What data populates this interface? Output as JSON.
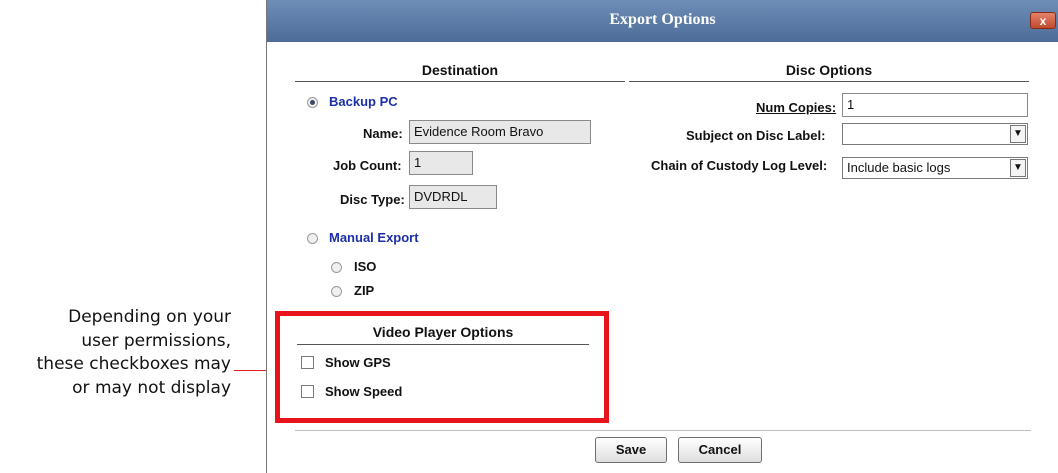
{
  "callout": {
    "lines": [
      "Depending on your",
      "user permissions,",
      "these checkboxes may",
      "or may not display"
    ]
  },
  "dialog": {
    "title": "Export Options",
    "close_label": "x"
  },
  "destination": {
    "heading": "Destination",
    "backup_pc": {
      "label": "Backup PC",
      "selected": true,
      "name_label": "Name:",
      "name_value": "Evidence Room Bravo",
      "job_count_label": "Job Count:",
      "job_count_value": "1",
      "disc_type_label": "Disc Type:",
      "disc_type_value": "DVDRDL"
    },
    "manual_export": {
      "label": "Manual Export",
      "selected": false,
      "options": [
        "ISO",
        "ZIP"
      ]
    }
  },
  "disc_options": {
    "heading": "Disc Options",
    "num_copies_label": "Num Copies:",
    "num_copies_value": "1",
    "subject_label": "Subject on Disc Label:",
    "subject_value": "",
    "custody_label": "Chain of Custody Log Level:",
    "custody_value": "Include basic logs"
  },
  "video_player": {
    "heading": "Video Player Options",
    "show_gps": "Show GPS",
    "show_speed": "Show Speed"
  },
  "buttons": {
    "save": "Save",
    "cancel": "Cancel"
  },
  "colors": {
    "titlebar": "#5b7aa6",
    "highlight_box": "#e8141c",
    "link_blue": "#1c2fa6"
  }
}
